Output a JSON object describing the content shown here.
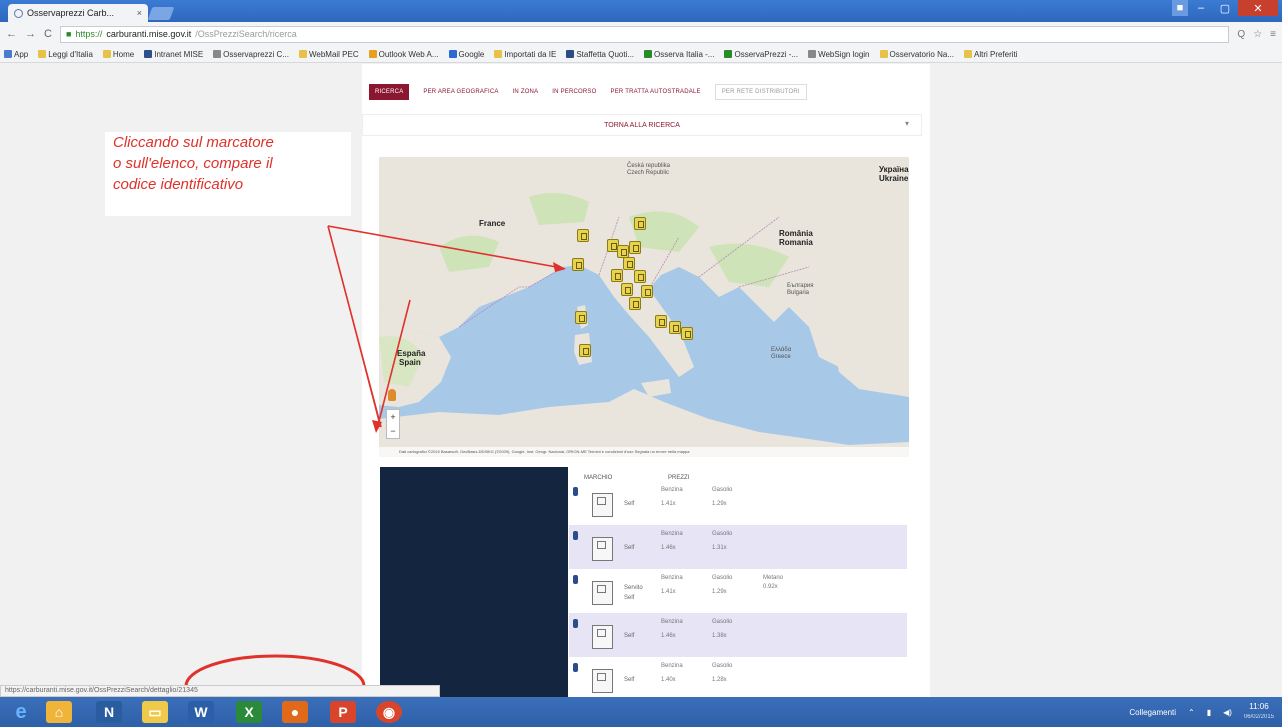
{
  "browser": {
    "tab_title": "Osservaprezzi Carb...",
    "tab_close": "×",
    "address": {
      "scheme": "https://",
      "host": "carburanti.mise.gov.it",
      "path": "/OssPrezziSearch/ricerca"
    },
    "status_url": "https://carburanti.mise.gov.it/OssPrezziSearch/dettaglio/21345",
    "bookmarks": [
      {
        "label": "App",
        "color": "#4a7bd0"
      },
      {
        "label": "Leggi d'Italia",
        "color": "#e8c14a"
      },
      {
        "label": "Home",
        "color": "#e8c14a"
      },
      {
        "label": "Intranet MISE",
        "color": "#2e4f8e"
      },
      {
        "label": "Osservaprezzi C...",
        "color": "#888888"
      },
      {
        "label": "WebMail PEC",
        "color": "#e8c14a"
      },
      {
        "label": "Outlook Web A...",
        "color": "#e8a020"
      },
      {
        "label": "Google",
        "color": "#2d6ad4"
      },
      {
        "label": "Importati da IE",
        "color": "#e8c14a"
      },
      {
        "label": "Staffetta Quoti...",
        "color": "#2b4b8a"
      },
      {
        "label": "Osserva Italia -...",
        "color": "#2a8a2a"
      },
      {
        "label": "OsservaPrezzi -...",
        "color": "#2a8a2a"
      },
      {
        "label": "WebSign login",
        "color": "#888888"
      },
      {
        "label": "Osservatorio Na...",
        "color": "#e8c14a"
      },
      {
        "label": "Altri Preferiti",
        "color": "#e8c14a"
      }
    ]
  },
  "page": {
    "tabs": [
      {
        "label": "Ricerca",
        "style": "active"
      },
      {
        "label": "Per area geografica",
        "style": ""
      },
      {
        "label": "In zona",
        "style": ""
      },
      {
        "label": "In percorso",
        "style": ""
      },
      {
        "label": "Per tratta autostradale",
        "style": ""
      },
      {
        "label": "Per rete distributori",
        "style": "outlined"
      }
    ],
    "back_label": "Torna alla ricerca",
    "map": {
      "labels": [
        {
          "text": "France"
        },
        {
          "text": "España"
        },
        {
          "text": "Spain"
        },
        {
          "text": "România"
        },
        {
          "text": "Romania"
        },
        {
          "text": "Україна"
        },
        {
          "text": "Ukraine"
        },
        {
          "text": "България"
        },
        {
          "text": "Bulgaria"
        },
        {
          "text": "Ελλάδα"
        },
        {
          "text": "Greece"
        },
        {
          "text": "Česká republika"
        },
        {
          "text": "Czech Republic"
        }
      ],
      "attribution": "Dati cartografici ©2015 Basarsoft, GeoBasis-DE/BKG (©2009), Google, Inst. Geogr. Nacional, ORION-ME  Termini e condizioni d'uso  Segnala un errore nella mappa",
      "zoom_in": "+",
      "zoom_out": "−"
    },
    "list": {
      "col_brand": "Marchio",
      "col_prices": "Prezzi",
      "rows": [
        {
          "alt": false,
          "mode": "Self",
          "fuels": [
            {
              "name": "Benzina",
              "price": "1.41x"
            },
            {
              "name": "Gasolio",
              "price": "1.29x"
            }
          ]
        },
        {
          "alt": true,
          "mode": "Self",
          "fuels": [
            {
              "name": "Benzina",
              "price": "1.46x"
            },
            {
              "name": "Gasolio",
              "price": "1.31x"
            }
          ]
        },
        {
          "alt": false,
          "mode": "Servito",
          "mode2": "Self",
          "fuels": [
            {
              "name": "Benzina",
              "price": "1.41x"
            },
            {
              "name": "Gasolio",
              "price": "1.29x"
            },
            {
              "name": "Metano",
              "price": "0.92x"
            }
          ]
        },
        {
          "alt": true,
          "mode": "Self",
          "fuels": [
            {
              "name": "Benzina",
              "price": "1.46x"
            },
            {
              "name": "Gasolio",
              "price": "1.38x"
            }
          ]
        },
        {
          "alt": false,
          "mode": "Self",
          "fuels": [
            {
              "name": "Benzina",
              "price": "1.40x"
            },
            {
              "name": "Gasolio",
              "price": "1.28x"
            }
          ]
        }
      ]
    }
  },
  "annotation": {
    "lines": [
      "Cliccando sul marcatore",
      "o sull'elenco, compare il",
      "codice identificativo"
    ],
    "color": "#e0312a"
  },
  "taskbar": {
    "tray_label": "Collegamenti",
    "time": "11:06",
    "date": "06/02/2015"
  }
}
